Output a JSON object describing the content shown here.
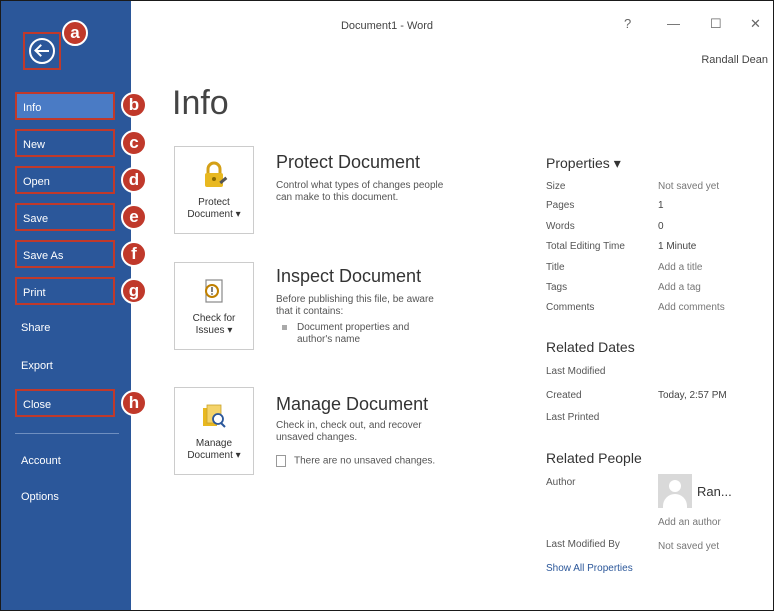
{
  "window": {
    "title": "Document1 - Word",
    "help": "?",
    "minimize": "—",
    "maximize": "☐",
    "close": "✕",
    "user": "Randall Dean"
  },
  "sidebar": {
    "items": [
      {
        "label": "Info"
      },
      {
        "label": "New"
      },
      {
        "label": "Open"
      },
      {
        "label": "Save"
      },
      {
        "label": "Save As"
      },
      {
        "label": "Print"
      },
      {
        "label": "Share"
      },
      {
        "label": "Export"
      },
      {
        "label": "Close"
      },
      {
        "label": "Account"
      },
      {
        "label": "Options"
      }
    ]
  },
  "callouts": [
    "a",
    "b",
    "c",
    "d",
    "e",
    "f",
    "g",
    "h"
  ],
  "main": {
    "title": "Info",
    "protect": {
      "tile_line1": "Protect",
      "tile_line2": "Document ▾",
      "heading": "Protect Document",
      "desc_line1": "Control what types of changes people",
      "desc_line2": "can make to this document."
    },
    "inspect": {
      "tile_line1": "Check for",
      "tile_line2": "Issues ▾",
      "heading": "Inspect Document",
      "desc_line1": "Before publishing this file, be aware",
      "desc_line2": "that it contains:",
      "bullet_line1": "Document properties and",
      "bullet_line2": "author's name"
    },
    "manage": {
      "tile_line1": "Manage",
      "tile_line2": "Document ▾",
      "heading": "Manage Document",
      "desc_line1": "Check in, check out, and recover",
      "desc_line2": "unsaved changes.",
      "note": "There are no unsaved changes."
    }
  },
  "properties": {
    "heading": "Properties ▾",
    "rows": [
      {
        "key": "Size",
        "value": "Not saved yet"
      },
      {
        "key": "Pages",
        "value": "1"
      },
      {
        "key": "Words",
        "value": "0"
      },
      {
        "key": "Total Editing Time",
        "value": "1 Minute"
      },
      {
        "key": "Title",
        "value": "Add a title"
      },
      {
        "key": "Tags",
        "value": "Add a tag"
      },
      {
        "key": "Comments",
        "value": "Add comments"
      }
    ],
    "related_dates": {
      "heading": "Related Dates",
      "last_modified": "Last Modified",
      "created": "Created",
      "created_value": "Today, 2:57 PM",
      "last_printed": "Last Printed"
    },
    "related_people": {
      "heading": "Related People",
      "author": "Author",
      "author_name": "Ran...",
      "add_author": "Add an author",
      "last_modified_by": "Last Modified By",
      "last_modified_by_value": "Not saved yet"
    },
    "show_all": "Show All Properties"
  },
  "colors": {
    "sidebar": "#2b579a",
    "selected": "#4a7bc5",
    "callout": "#c0392b"
  }
}
